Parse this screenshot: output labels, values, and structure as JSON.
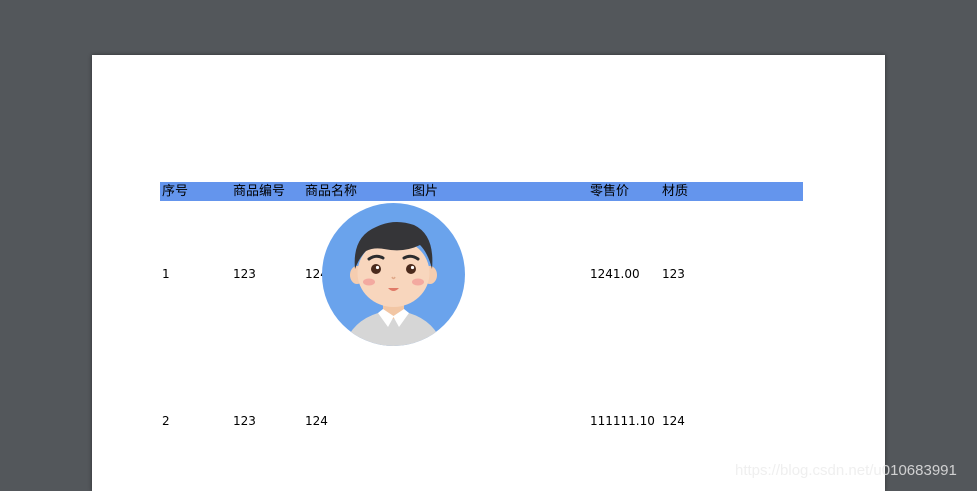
{
  "table": {
    "headers": [
      "序号",
      "商品编号",
      "商品名称",
      "图片",
      "零售价",
      "材质"
    ],
    "rows": [
      {
        "index": "1",
        "code": "123",
        "name": "124",
        "price": "1241.00",
        "material": "123"
      },
      {
        "index": "2",
        "code": "123",
        "name": "124",
        "price": "111111.10",
        "material": "124"
      }
    ]
  },
  "colors": {
    "header_bg": "#6495ed",
    "viewer_bg": "#53575b",
    "page_bg": "#ffffff",
    "avatar_bg": "#6aa3ec"
  },
  "image": {
    "icon": "avatar-boy-image"
  },
  "watermark": "https://blog.csdn.net/u010683991"
}
